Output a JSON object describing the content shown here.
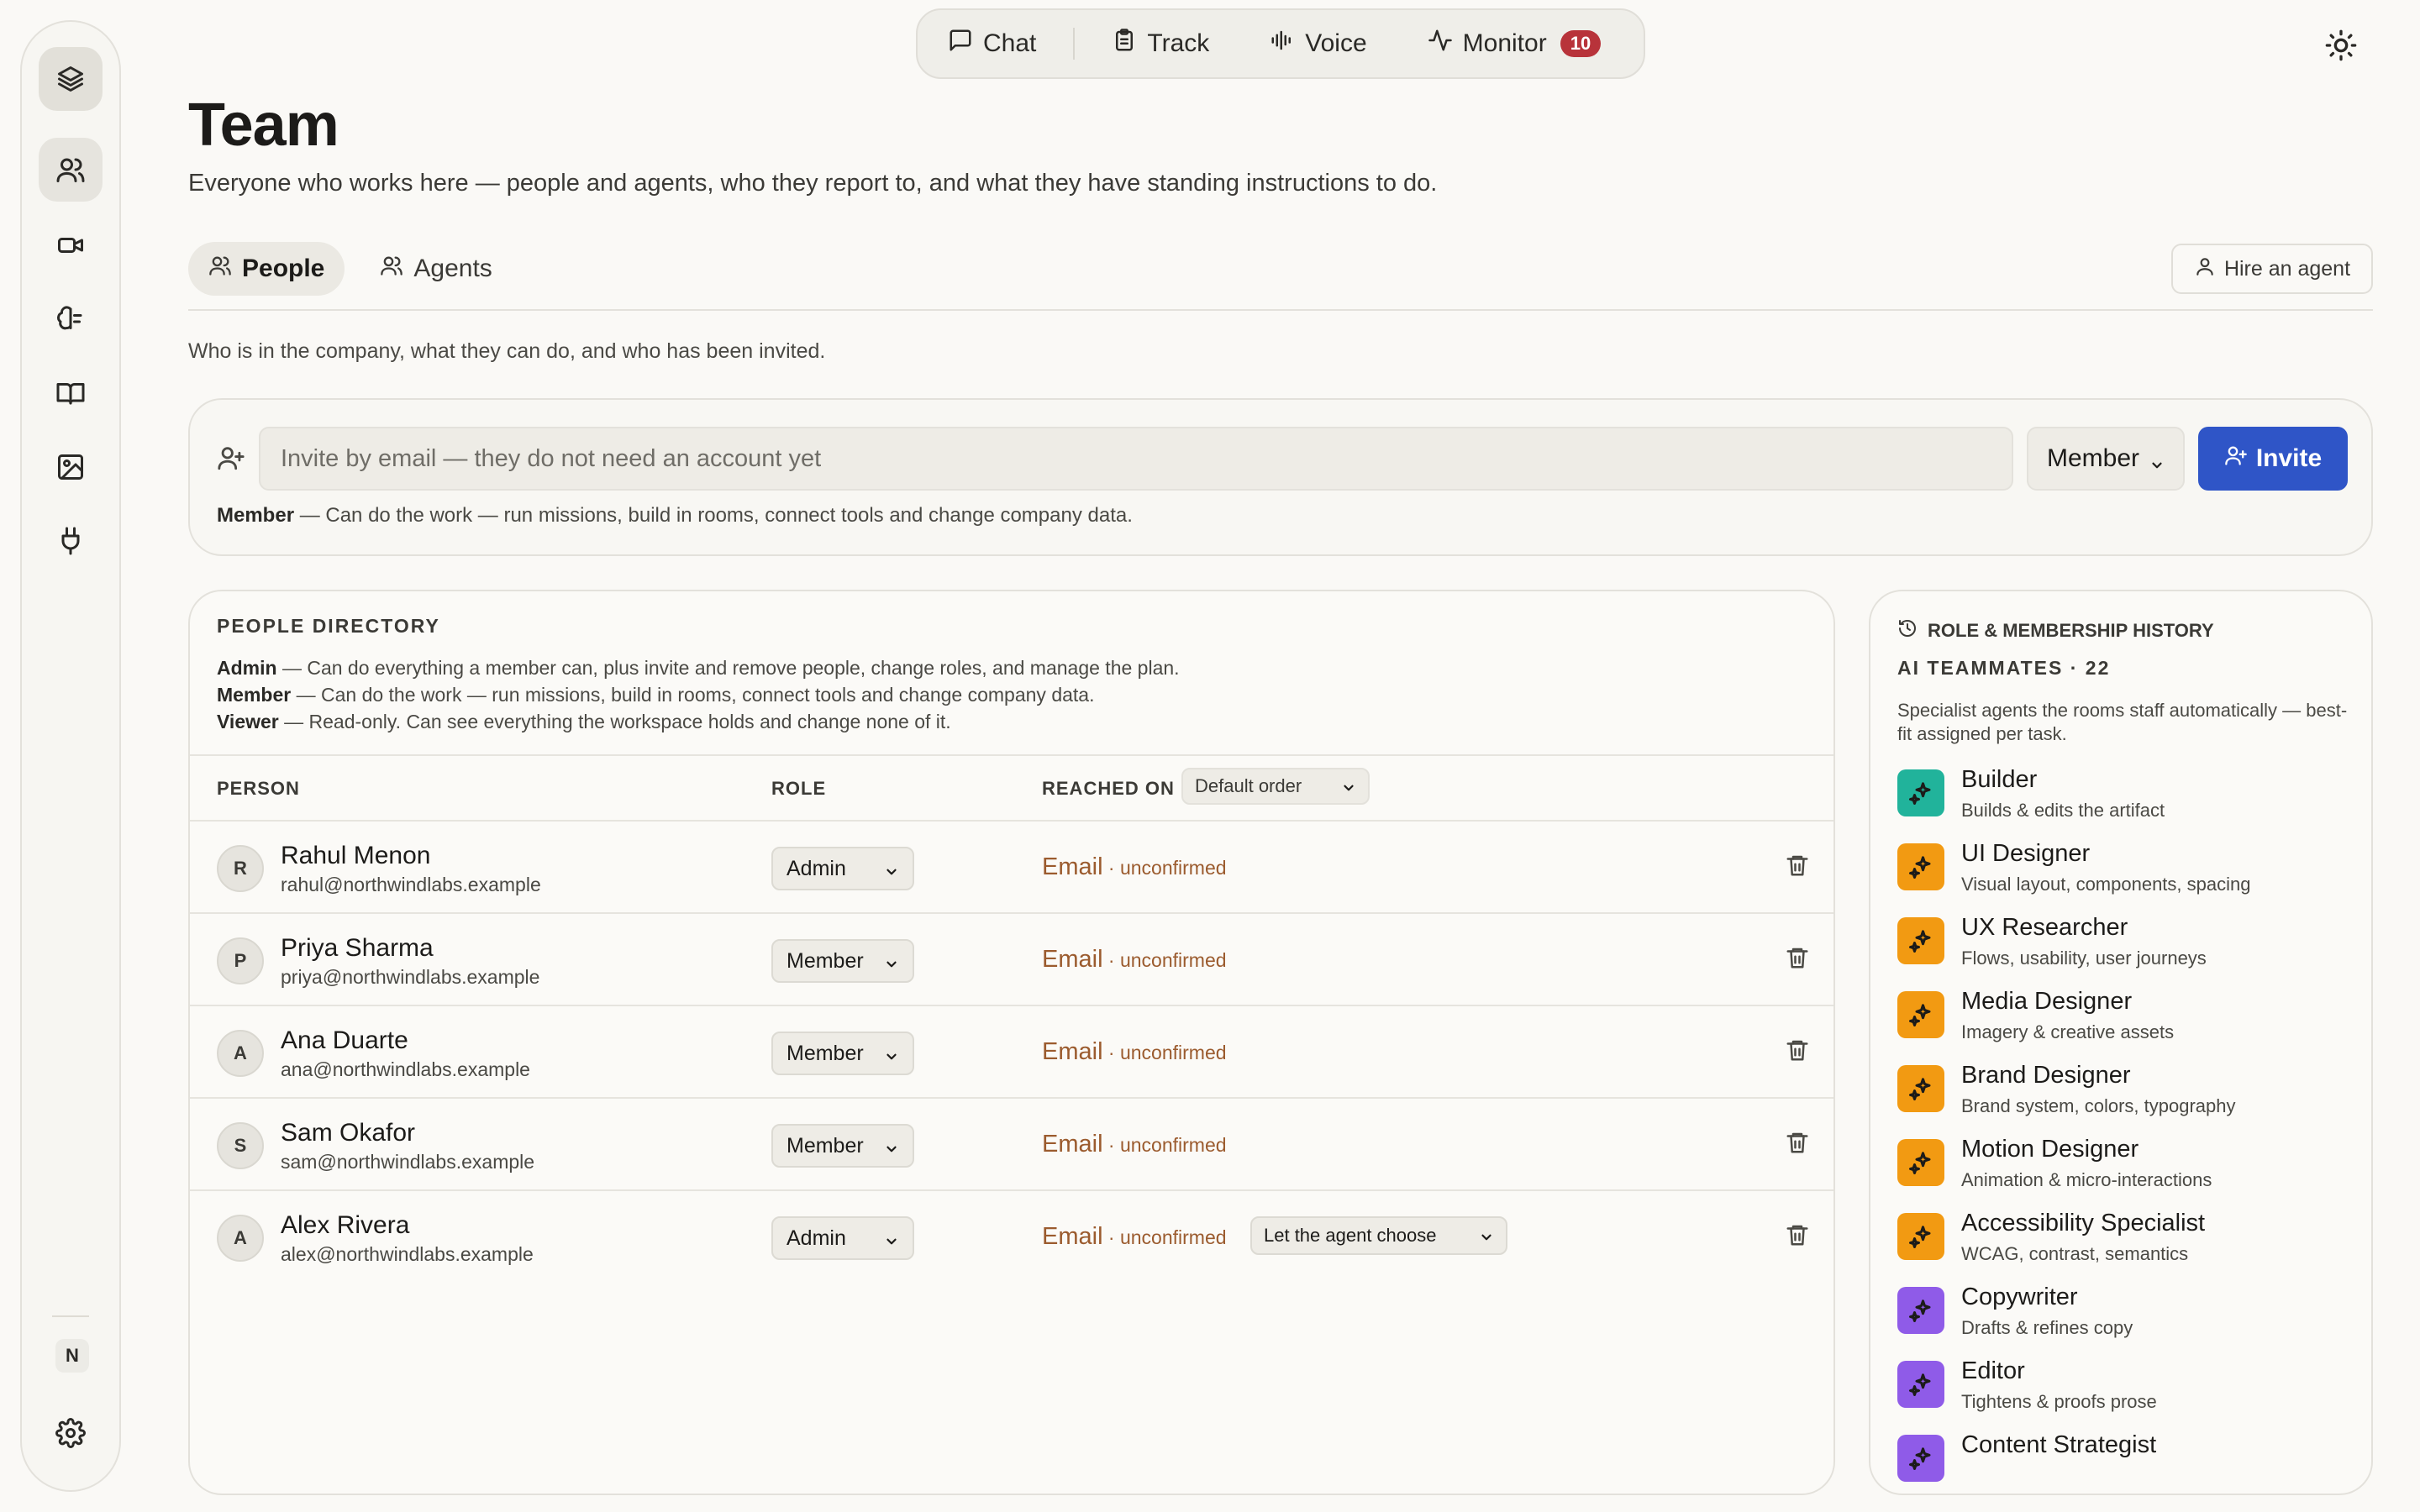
{
  "nav": {
    "chat": "Chat",
    "track": "Track",
    "voice": "Voice",
    "monitor": "Monitor",
    "monitor_badge": "10"
  },
  "rail": {
    "workspace_initial": "N"
  },
  "header": {
    "title": "Team",
    "subtitle": "Everyone who works here — people and agents, who they report to, and what they have standing instructions to do."
  },
  "tabs": {
    "people": "People",
    "agents": "Agents",
    "hire": "Hire an agent"
  },
  "section_desc": "Who is in the company, what they can do, and who has been invited.",
  "invite": {
    "placeholder": "Invite by email — they do not need an account yet",
    "role": "Member",
    "button": "Invite",
    "hint_role": "Member",
    "hint_text": " — Can do the work — run missions, build in rooms, connect tools and change company data."
  },
  "directory": {
    "title": "PEOPLE DIRECTORY",
    "roles": [
      {
        "name": "Admin",
        "desc": " — Can do everything a member can, plus invite and remove people, change roles, and manage the plan."
      },
      {
        "name": "Member",
        "desc": " — Can do the work — run missions, build in rooms, connect tools and change company data."
      },
      {
        "name": "Viewer",
        "desc": " — Read-only. Can see everything the workspace holds and change none of it."
      }
    ],
    "columns": {
      "person": "PERSON",
      "role": "ROLE",
      "reached": "REACHED ON"
    },
    "order": "Default order",
    "channel": "Email",
    "status": " · unconfirmed",
    "agent_choose": "Let the agent choose",
    "people": [
      {
        "initial": "R",
        "name": "Rahul Menon",
        "email": "rahul@northwindlabs.example",
        "role": "Admin"
      },
      {
        "initial": "P",
        "name": "Priya Sharma",
        "email": "priya@northwindlabs.example",
        "role": "Member"
      },
      {
        "initial": "A",
        "name": "Ana Duarte",
        "email": "ana@northwindlabs.example",
        "role": "Member"
      },
      {
        "initial": "S",
        "name": "Sam Okafor",
        "email": "sam@northwindlabs.example",
        "role": "Member"
      },
      {
        "initial": "A",
        "name": "Alex Rivera",
        "email": "alex@northwindlabs.example",
        "role": "Admin"
      }
    ]
  },
  "history": {
    "title": "ROLE & MEMBERSHIP HISTORY",
    "subtitle": "AI TEAMMATES · 22",
    "desc": "Specialist agents the rooms staff automatically — best-fit assigned per task.",
    "agents": [
      {
        "name": "Builder",
        "desc": "Builds & edits the artifact",
        "color": "#21b39b"
      },
      {
        "name": "UI Designer",
        "desc": "Visual layout, components, spacing",
        "color": "#f29a12"
      },
      {
        "name": "UX Researcher",
        "desc": "Flows, usability, user journeys",
        "color": "#f29a12"
      },
      {
        "name": "Media Designer",
        "desc": "Imagery & creative assets",
        "color": "#f29a12"
      },
      {
        "name": "Brand Designer",
        "desc": "Brand system, colors, typography",
        "color": "#f29a12"
      },
      {
        "name": "Motion Designer",
        "desc": "Animation & micro-interactions",
        "color": "#f29a12"
      },
      {
        "name": "Accessibility Specialist",
        "desc": "WCAG, contrast, semantics",
        "color": "#f29a12"
      },
      {
        "name": "Copywriter",
        "desc": "Drafts & refines copy",
        "color": "#8f5be8"
      },
      {
        "name": "Editor",
        "desc": "Tightens & proofs prose",
        "color": "#8f5be8"
      },
      {
        "name": "Content Strategist",
        "desc": "",
        "color": "#8f5be8"
      }
    ]
  },
  "colors": {
    "accent": "#2f55c7",
    "badge": "#b8333a",
    "email": "#9b5b2e"
  }
}
